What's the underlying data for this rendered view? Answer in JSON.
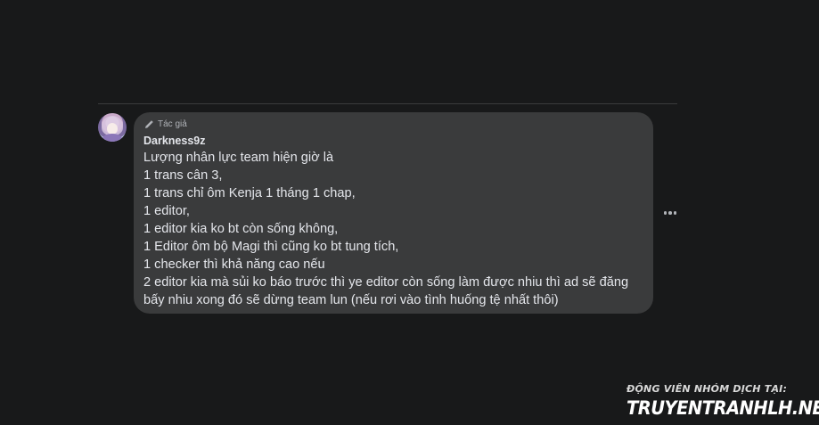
{
  "comment": {
    "avatar_icon": "user-avatar-anime",
    "badge_icon": "pencil-icon",
    "badge_label": "Tác giả",
    "author": "Darkness9z",
    "lines": [
      "Lượng nhân lực team hiện giờ là",
      "1 trans cân 3,",
      "1 trans chỉ ôm Kenja 1 tháng 1 chap,",
      "1 editor,",
      "1 editor kia ko bt còn sống không,",
      "1 Editor ôm bộ Magi thì cũng ko bt tung tích,",
      "1 checker thì khả năng cao nếu",
      "2 editor kia mà sủi ko báo trước thì ye editor còn sống làm được nhiu thì ad sẽ đăng",
      "bấy nhiu xong đó sẽ dừng team lun (nếu rơi vào tình huống tệ nhất thôi)"
    ],
    "more_icon": "more-options-icon"
  },
  "watermark": {
    "top": "ĐỘNG VIÊN NHÓM DỊCH TẠI:",
    "main": "TRUYENTRANHLH.NET"
  },
  "colors": {
    "background": "#18191a",
    "bubble": "#3a3b3c",
    "text": "#e4e6eb",
    "secondary_text": "#b0b3b8"
  }
}
